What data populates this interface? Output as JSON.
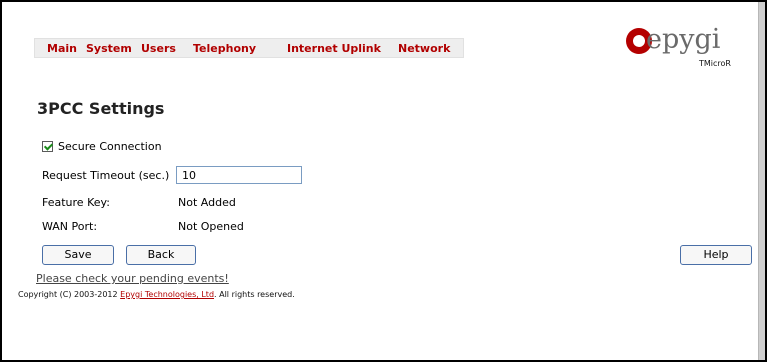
{
  "menu": {
    "items": [
      {
        "label": "Main"
      },
      {
        "label": "System"
      },
      {
        "label": "Users"
      },
      {
        "label": "Telephony"
      },
      {
        "label": "Internet Uplink"
      },
      {
        "label": "Network"
      }
    ]
  },
  "logo": {
    "word": "epygi",
    "sub": "TMicroR",
    "brand_color": "#b40000"
  },
  "page": {
    "title": "3PCC Settings"
  },
  "form": {
    "secure_connection_label": "Secure Connection",
    "request_timeout_label": "Request Timeout (sec.)",
    "request_timeout_value": "10",
    "feature_key_label": "Feature Key:",
    "feature_key_value": "Not Added",
    "wan_port_label": "WAN Port:",
    "wan_port_value": "Not Opened"
  },
  "buttons": {
    "save": "Save",
    "back": "Back",
    "help": "Help"
  },
  "footer": {
    "pending_events": "Please check your pending events!",
    "copyright_prefix": "Copyright (C) 2003-2012 ",
    "company": "Epygi Technologies, Ltd",
    "copyright_suffix": ". All rights reserved."
  }
}
